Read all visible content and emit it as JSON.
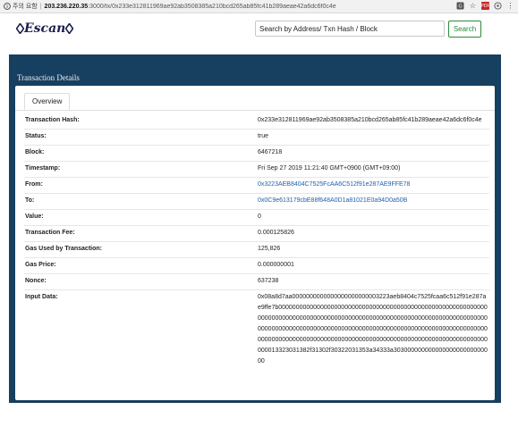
{
  "browser": {
    "security_label": "주의 요함",
    "url_host": "203.236.220.35",
    "url_path": ":3000/tx/0x233e312811969ae92ab3508385a210bcd265ab85fc41b289aeae42a6dc6f0c4e"
  },
  "nav": {
    "logo_text": "Escan",
    "search_placeholder": "Search by Address/ Txn Hash / Block",
    "search_button": "Search"
  },
  "panel": {
    "title": "Transaction Details",
    "tab_label": "Overview"
  },
  "details": [
    {
      "key": "Transaction Hash:",
      "value": "0x233e312811969ae92ab3508385a210bcd265ab85fc41b289aeae42a6dc6f0c4e",
      "link": false
    },
    {
      "key": "Status:",
      "value": "true",
      "link": false
    },
    {
      "key": "Block:",
      "value": "6467218",
      "link": false
    },
    {
      "key": "Timestamp:",
      "value": "Fri Sep 27 2019 11:21:40 GMT+0900 (GMT+09:00)",
      "link": false
    },
    {
      "key": "From:",
      "value": "0x3223AEB8404C7525FcAA6C512f91e287AE9FFE78",
      "link": true
    },
    {
      "key": "To:",
      "value": "0x0C9e613179cbE88f648A0D1a81021E0a94D0a50B",
      "link": true
    },
    {
      "key": "Value:",
      "value": "0",
      "link": false
    },
    {
      "key": "Transaction Fee:",
      "value": "0.000125826",
      "link": false
    },
    {
      "key": "Gas Used by Transaction:",
      "value": "125,826",
      "link": false
    },
    {
      "key": "Gas Price:",
      "value": "0.000000001",
      "link": false
    },
    {
      "key": "Nonce:",
      "value": "637238",
      "link": false
    },
    {
      "key": "Input Data:",
      "value": "0x08a8d7aa0000000000000000000000003223aeb8404c7525fcaa6c512f91e287ae9ffe7b000000000000000000000000000000000000000000000000000000000000000000000000000000000000000000000000000000000000000000000000000000000000000000000000000000000000000000000000000000000000000000000000000000000000000000000000000000000000000000000000000000000000000000000013323031382f31302f30322031353a34333a30300000000000000000000000000",
      "link": false
    }
  ]
}
